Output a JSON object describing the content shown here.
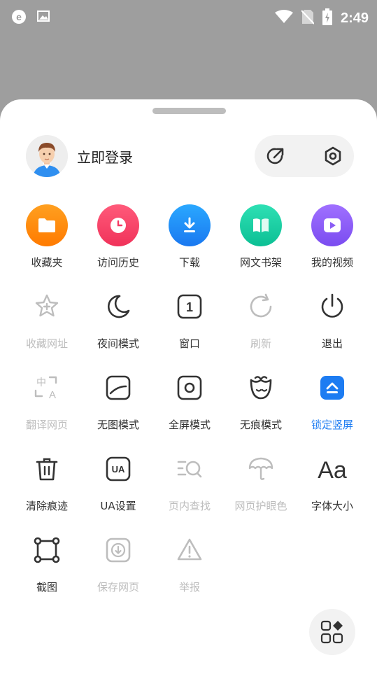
{
  "status_bar": {
    "time": "2:49"
  },
  "profile": {
    "login_label": "立即登录"
  },
  "quick_actions": {
    "share_icon": "share-arrow-icon",
    "settings_icon": "hexagon-settings-icon"
  },
  "grid": {
    "row1": [
      {
        "label": "收藏夹",
        "icon": "folder-icon",
        "color": "#ff8a00"
      },
      {
        "label": "访问历史",
        "icon": "clock-icon",
        "color": "#f53b64"
      },
      {
        "label": "下载",
        "icon": "download-icon",
        "color": "#1e88f5"
      },
      {
        "label": "网文书架",
        "icon": "book-icon",
        "color": "#12c9a0"
      },
      {
        "label": "我的视频",
        "icon": "video-play-icon",
        "color": "#8a5cf5"
      }
    ],
    "row2": [
      "收藏网址",
      "夜间模式",
      "窗口",
      "刷新",
      "退出"
    ],
    "window_count": "1",
    "row3": [
      "翻译网页",
      "无图模式",
      "全屏模式",
      "无痕模式",
      "锁定竖屏"
    ],
    "row4": [
      "清除痕迹",
      "UA设置",
      "页内查找",
      "网页护眼色",
      "字体大小"
    ],
    "ua_badge": "UA",
    "font_glyph": "Aa",
    "row5": [
      "截图",
      "保存网页",
      "举报"
    ]
  },
  "colors": {
    "accent": "#1d7cf2",
    "disabled": "#bdbdbd",
    "text": "#333333"
  }
}
